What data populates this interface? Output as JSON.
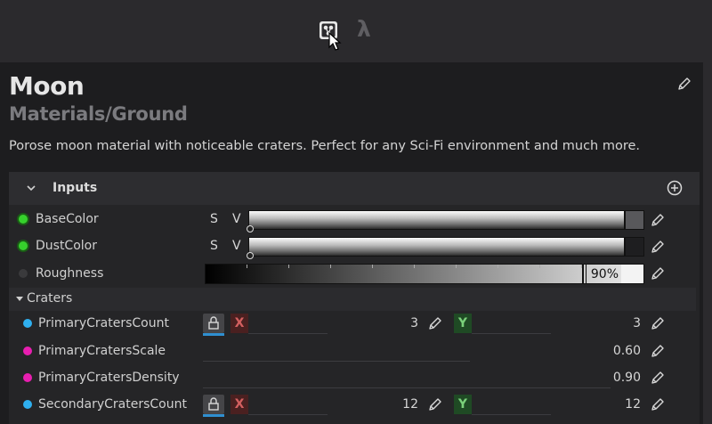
{
  "header": {
    "title": "Moon",
    "subtitle": "Materials/Ground",
    "description": "Porose moon material with noticeable craters. Perfect for any Sci-Fi environment and much more.",
    "toolbar_icons": [
      "node-graph-icon",
      "lambda-icon"
    ],
    "lambda_glyph": "λ"
  },
  "inputs": {
    "section_label": "Inputs",
    "colors": [
      {
        "label": "BaseColor",
        "s_label": "S",
        "v_label": "V",
        "swatch_color": "#58585b",
        "dot_color": "#36d12c"
      },
      {
        "label": "DustColor",
        "s_label": "S",
        "v_label": "V",
        "swatch_color": "#1e1e20",
        "dot_color": "#36d12c"
      }
    ],
    "roughness": {
      "label": "Roughness",
      "value_text": "90%",
      "value": 0.9,
      "dot_color": "#3a3a3c"
    },
    "craters": {
      "group_label": "Craters",
      "primary_count": {
        "label": "PrimaryCratersCount",
        "x_label": "X",
        "x_value": "3",
        "y_label": "Y",
        "y_value": "3",
        "dot_color": "#2fb0f0"
      },
      "primary_scale": {
        "label": "PrimaryCratersScale",
        "value": "0.60",
        "dot_color": "#e81eb0"
      },
      "primary_density": {
        "label": "PrimaryCratersDensity",
        "value": "0.90",
        "dot_color": "#e81eb0"
      },
      "secondary_count": {
        "label": "SecondaryCratersCount",
        "x_label": "X",
        "x_value": "12",
        "y_label": "Y",
        "y_value": "12",
        "dot_color": "#2fb0f0"
      }
    }
  },
  "colors": {
    "panel_bg": "#1d1d1f",
    "section_bg": "#252527",
    "accent_blue": "#2f8fd0"
  }
}
